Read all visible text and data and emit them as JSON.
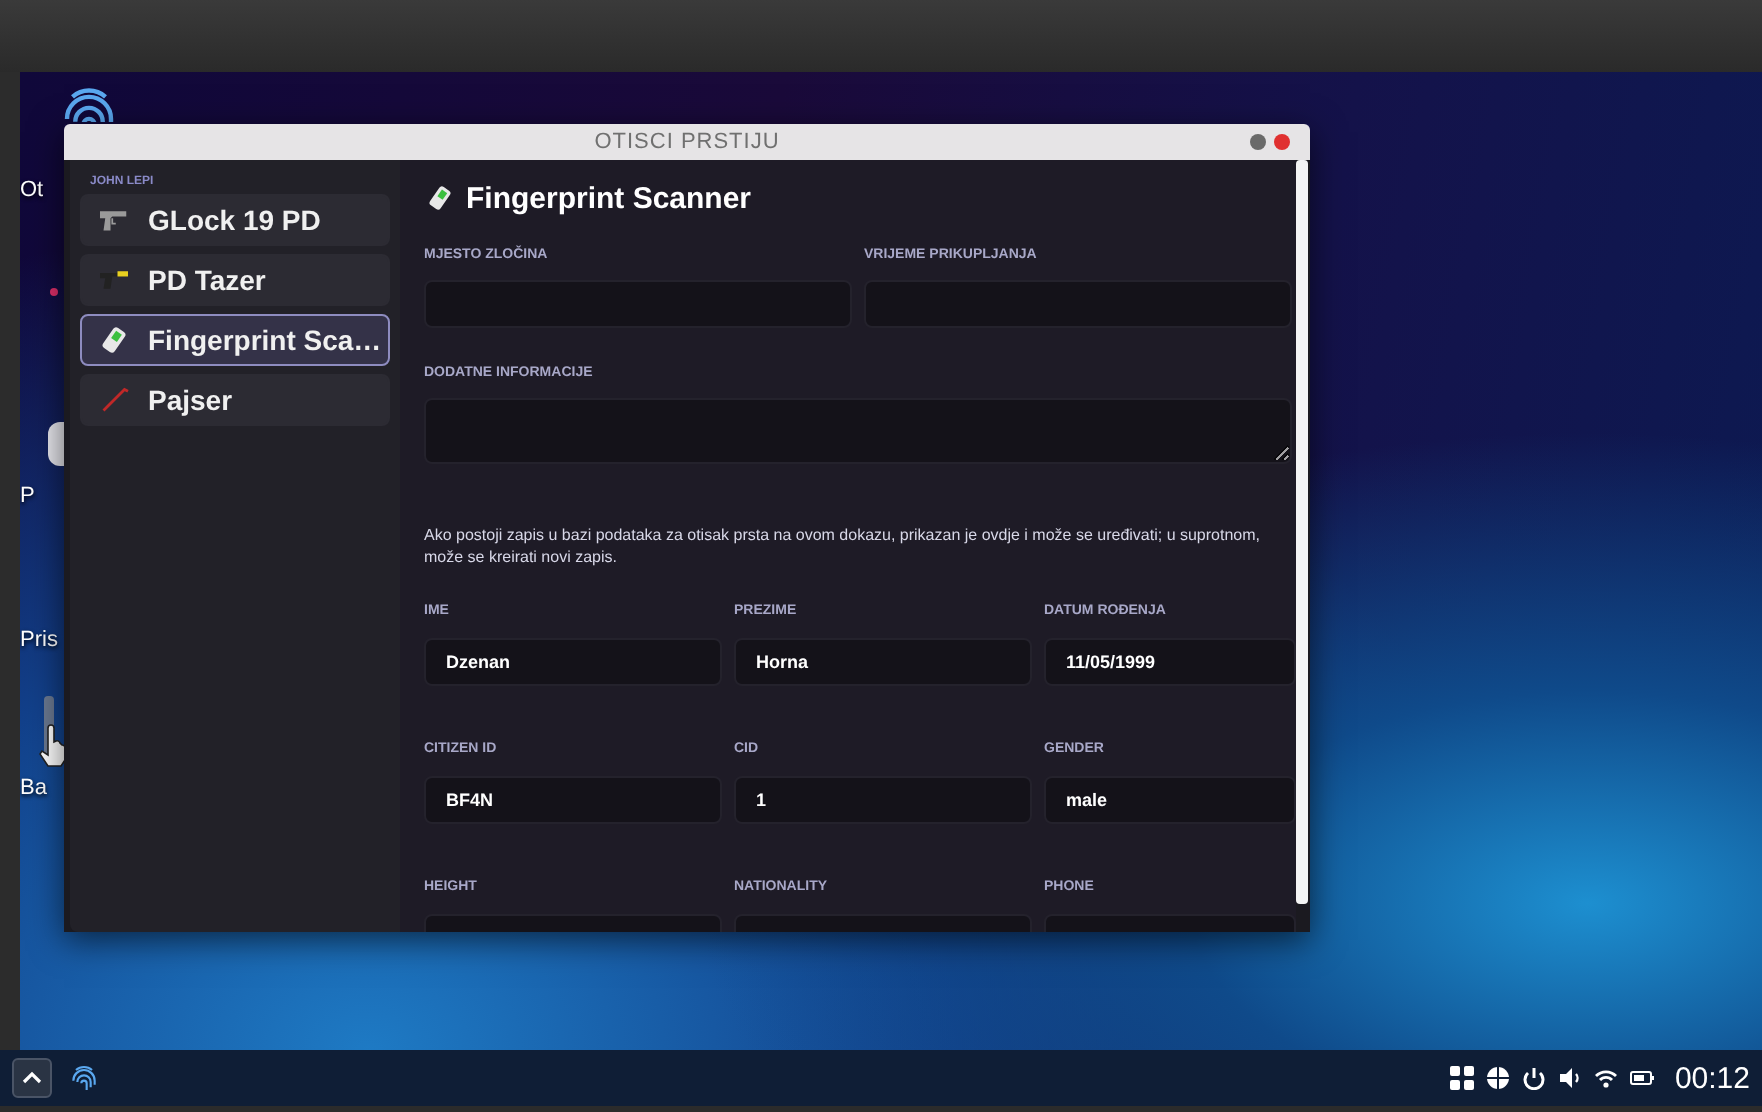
{
  "desktop_icons": [
    {
      "label": "Ot"
    },
    {
      "label": "P"
    },
    {
      "label": "Pris"
    },
    {
      "label": "Ba"
    }
  ],
  "window": {
    "title": "OTISCI PRSTIJU",
    "buttons": [
      {
        "kind": "minimize"
      },
      {
        "kind": "close"
      }
    ]
  },
  "sidebar": {
    "header": "JOHN LEPI",
    "items": [
      {
        "label": "GLock 19 PD",
        "selected": false
      },
      {
        "label": "PD Tazer",
        "selected": false
      },
      {
        "label": "Fingerprint Sca…",
        "selected": true
      },
      {
        "label": "Pajser",
        "selected": false
      }
    ]
  },
  "content": {
    "title": "Fingerprint Scanner",
    "evidence_fields": [
      {
        "label": "MJESTO ZLOČINA",
        "kind": "text"
      },
      {
        "label": "VRIJEME PRIKUPLJANJA",
        "kind": "text"
      },
      {
        "label": "DODATNE INFORMACIJE",
        "kind": "textarea"
      }
    ],
    "note": "Ako postoji zapis u bazi podataka za otisak prsta na ovom dokazu, prikazan je ovdje i može se uređivati; u suprotnom, može se kreirati novi zapis.",
    "record_rows": [
      [
        {
          "label": "IME",
          "value": "Dzenan"
        },
        {
          "label": "PREZIME",
          "value": "Horna"
        },
        {
          "label": "DATUM ROĐENJA",
          "value": "11/05/1999"
        }
      ],
      [
        {
          "label": "CITIZEN ID",
          "value": "BF4N"
        },
        {
          "label": "CID",
          "value": "1"
        },
        {
          "label": "GENDER",
          "value": "male"
        }
      ],
      [
        {
          "label": "HEIGHT"
        },
        {
          "label": "NATIONALITY"
        },
        {
          "label": "PHONE"
        }
      ]
    ]
  },
  "taskbar": {
    "clock": "00:12"
  }
}
